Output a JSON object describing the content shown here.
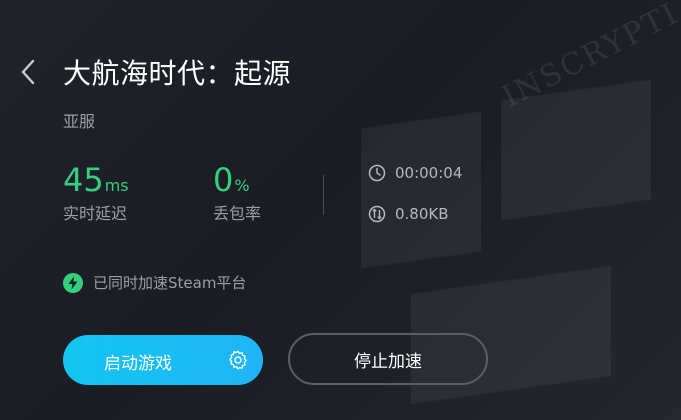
{
  "game": {
    "title": "大航海时代：起源",
    "region": "亚服"
  },
  "stats": {
    "latency_value": "45",
    "latency_unit": "ms",
    "latency_label": "实时延迟",
    "loss_value": "0",
    "loss_unit": "%",
    "loss_label": "丢包率"
  },
  "meta": {
    "duration": "00:00:04",
    "traffic": "0.80KB"
  },
  "sync_text": "已同时加速Steam平台",
  "buttons": {
    "start_label": "启动游戏",
    "stop_label": "停止加速"
  },
  "background": {
    "watermark": "INSCRYPTI"
  },
  "colors": {
    "accent_green": "#35d07f",
    "accent_blue": "#12c6f0"
  },
  "icons": {
    "back": "chevron-left-icon",
    "clock": "clock-icon",
    "traffic": "traffic-icon",
    "bolt": "lightning-icon",
    "gear": "gear-icon"
  }
}
